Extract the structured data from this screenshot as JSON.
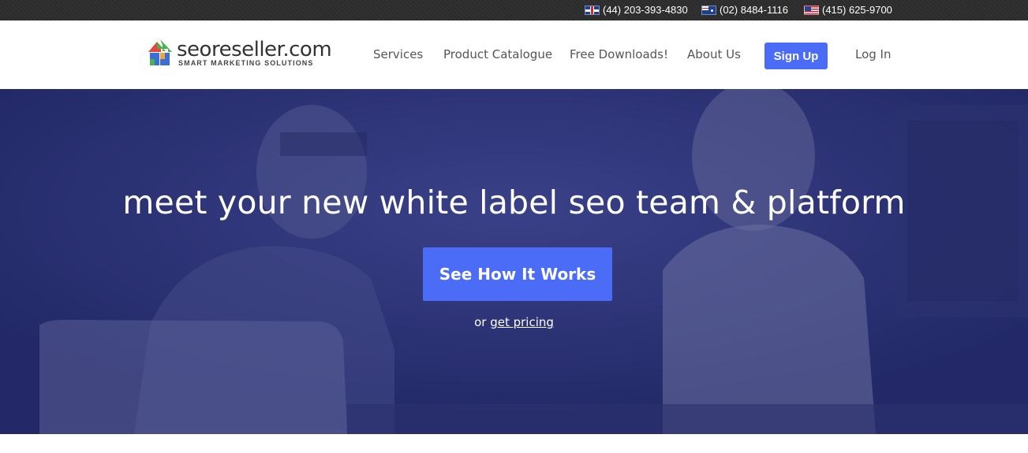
{
  "topbar": {
    "phones": [
      {
        "flag": "uk-flag-icon",
        "number": "(44) 203-393-4830"
      },
      {
        "flag": "au-flag-icon",
        "number": "(02) 8484-1116"
      },
      {
        "flag": "us-flag-icon",
        "number": "(415) 625-9700"
      }
    ]
  },
  "brand": {
    "name": "seoreseller.com",
    "tagline": "SMART MARKETING SOLUTIONS",
    "colors": {
      "red": "#e8463a",
      "green": "#4caf50",
      "blue": "#3a6fd8",
      "orange": "#f3a531"
    }
  },
  "nav": {
    "services": "Services",
    "catalogue": "Product Catalogue",
    "downloads": "Free Downloads!",
    "about": "About Us",
    "signup": "Sign Up",
    "login": "Log In"
  },
  "hero": {
    "title": "meet your new white label seo team & platform",
    "cta": "See How It Works",
    "alt_prefix": "or",
    "alt_link": "get pricing"
  },
  "colors": {
    "accent": "#4a6cf7",
    "topbar": "#2b2b2b",
    "hero_overlay": "#20286e"
  }
}
